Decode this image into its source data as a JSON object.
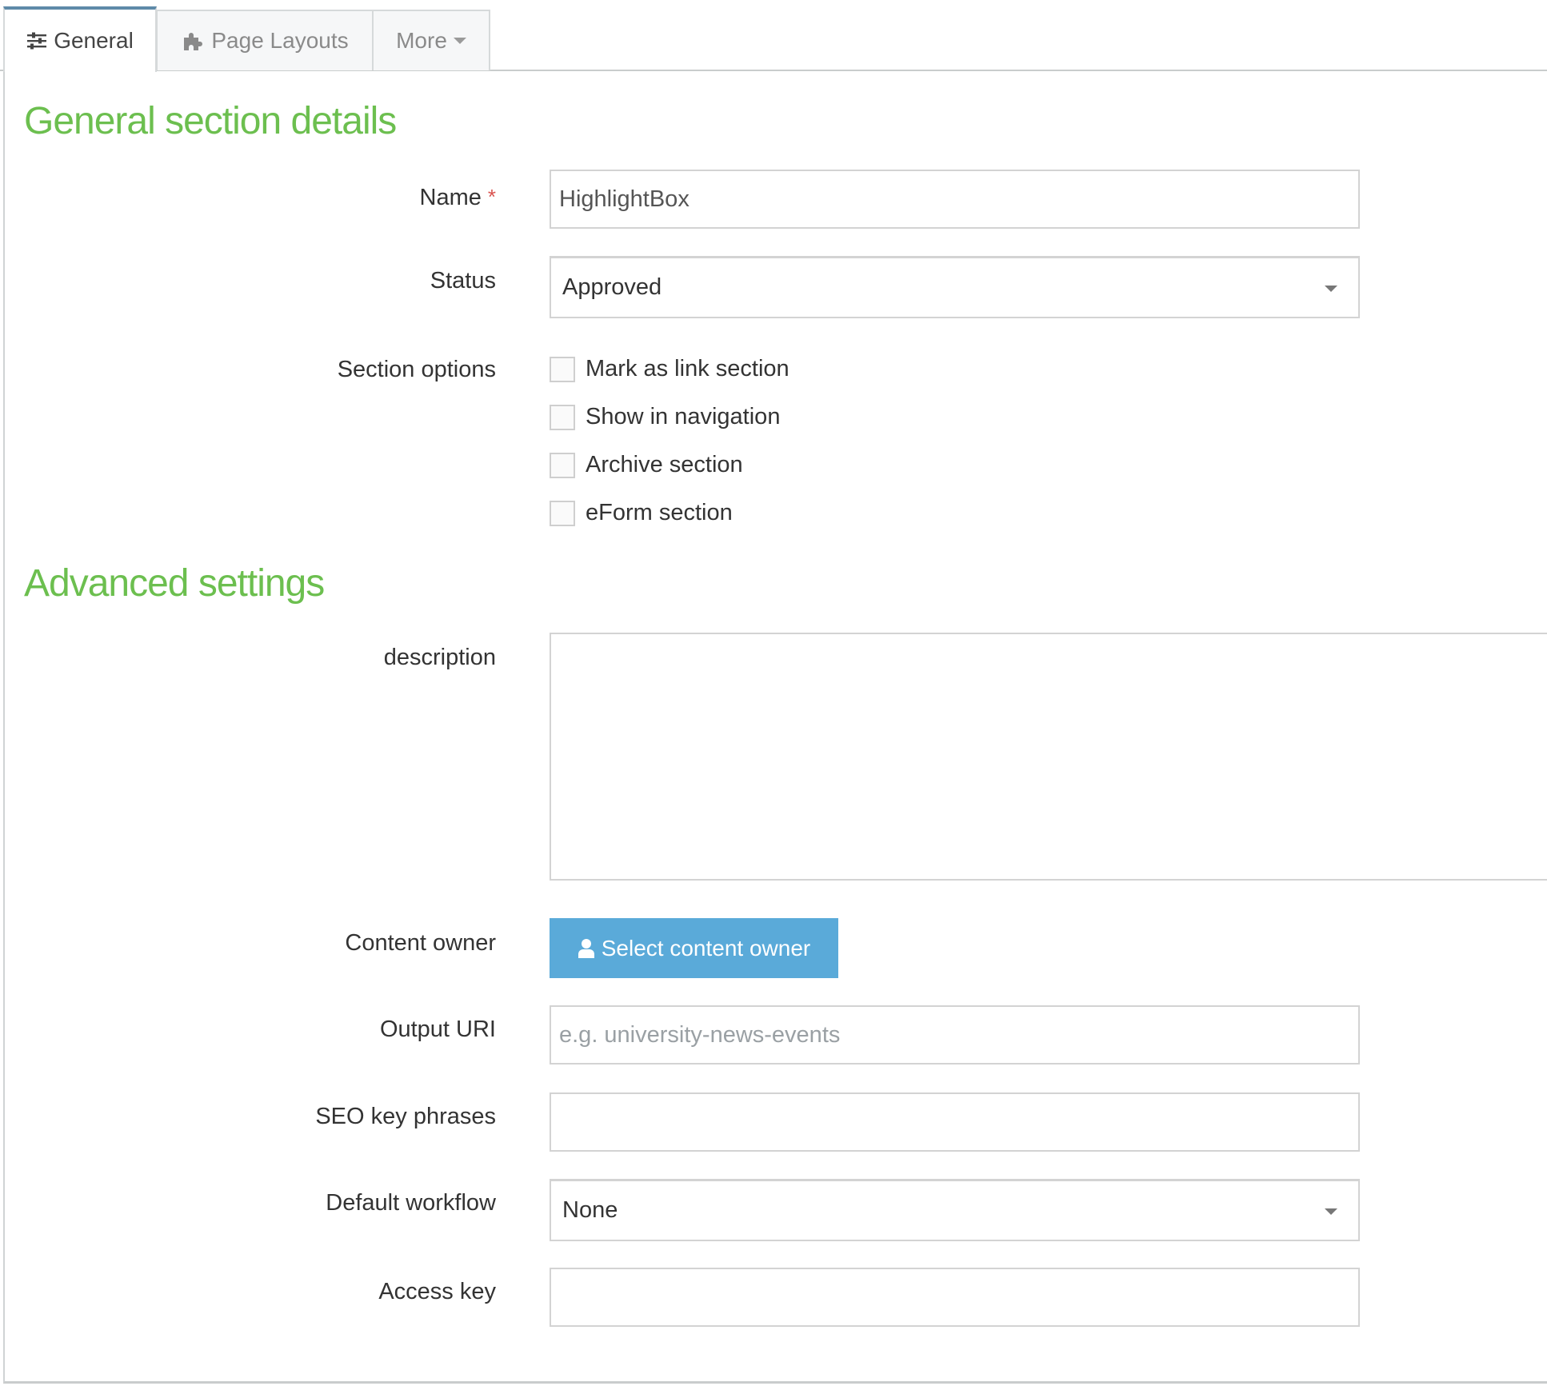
{
  "tabs": [
    {
      "label": "General",
      "icon": "sliders-icon",
      "active": true
    },
    {
      "label": "Page Layouts",
      "icon": "puzzle-icon",
      "active": false
    },
    {
      "label": "More",
      "icon": "caret-down-icon",
      "active": false
    }
  ],
  "sections": {
    "general_title": "General section details",
    "advanced_title": "Advanced settings"
  },
  "form": {
    "name": {
      "label": "Name",
      "required_mark": "*",
      "value": "HighlightBox"
    },
    "status": {
      "label": "Status",
      "value": "Approved"
    },
    "section_options": {
      "label": "Section options",
      "options": [
        {
          "label": "Mark as link section",
          "checked": false
        },
        {
          "label": "Show in navigation",
          "checked": false
        },
        {
          "label": "Archive section",
          "checked": false
        },
        {
          "label": "eForm section",
          "checked": false
        }
      ]
    },
    "description": {
      "label": "description",
      "value": ""
    },
    "content_owner": {
      "label": "Content owner",
      "button_label": "Select content owner"
    },
    "output_uri": {
      "label": "Output URI",
      "value": "",
      "placeholder": "e.g. university-news-events"
    },
    "seo_key_phrases": {
      "label": "SEO key phrases",
      "value": ""
    },
    "default_workflow": {
      "label": "Default workflow",
      "value": "None"
    },
    "access_key": {
      "label": "Access key",
      "value": ""
    }
  },
  "colors": {
    "heading_green": "#6cbf4f",
    "button_blue": "#5aaad9",
    "required_red": "#d9534f",
    "active_tab_border": "#5e8aa8"
  }
}
